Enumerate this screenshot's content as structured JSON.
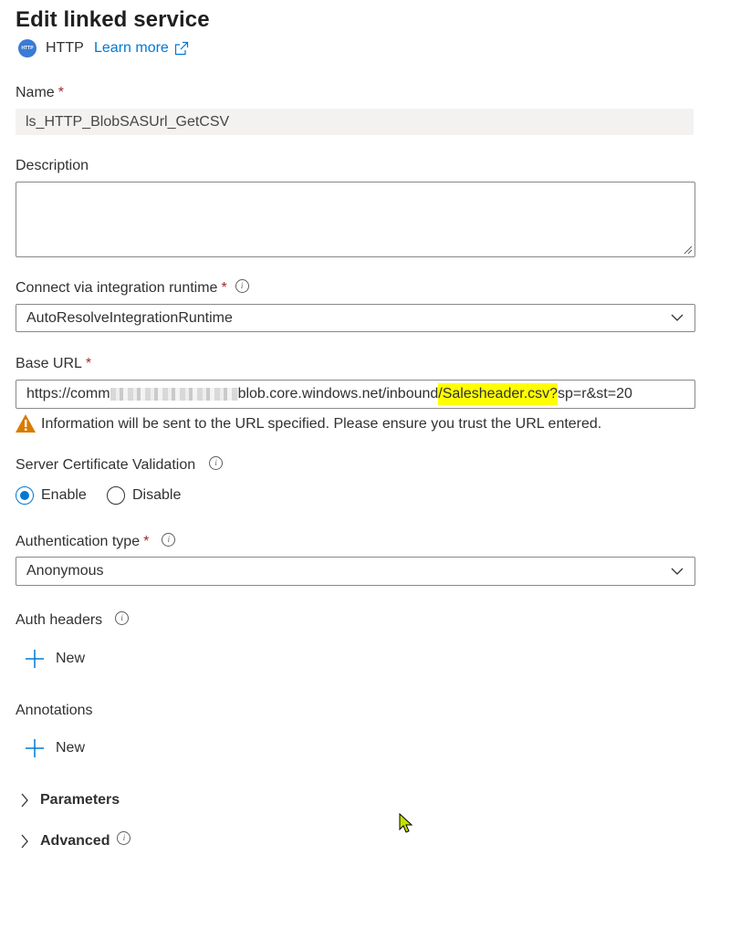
{
  "panel": {
    "title": "Edit linked service",
    "service_icon_text": "HTTP",
    "service_name": "HTTP",
    "learn_more": "Learn more"
  },
  "name": {
    "label": "Name",
    "required": "*",
    "value": "ls_HTTP_BlobSASUrl_GetCSV"
  },
  "description": {
    "label": "Description",
    "value": ""
  },
  "runtime": {
    "label": "Connect via integration runtime",
    "required": "*",
    "value": "AutoResolveIntegrationRuntime"
  },
  "base_url": {
    "label": "Base URL",
    "required": "*",
    "value_prefix": "https://comm",
    "value_middle": "blob.core.windows.net/inbound",
    "value_highlight": "/Salesheader.csv?",
    "value_suffix": "sp=r&st=20",
    "warning": "Information will be sent to the URL specified. Please ensure you trust the URL entered."
  },
  "cert_validation": {
    "label": "Server Certificate Validation",
    "options": [
      "Enable",
      "Disable"
    ],
    "selected": "Enable"
  },
  "auth_type": {
    "label": "Authentication type",
    "required": "*",
    "value": "Anonymous"
  },
  "auth_headers": {
    "label": "Auth headers",
    "new_label": "New"
  },
  "annotations": {
    "label": "Annotations",
    "new_label": "New"
  },
  "parameters": {
    "label": "Parameters"
  },
  "advanced": {
    "label": "Advanced"
  },
  "icons": {
    "service": "http-globe-icon",
    "external": "external-link-icon",
    "info": "info-icon",
    "chevron": "chevron-down-icon",
    "warning": "warning-icon",
    "add": "plus-icon",
    "expand": "chevron-right-icon",
    "cursor": "mouse-pointer-icon"
  },
  "colors": {
    "accent": "#0078d4",
    "required": "#a4262c",
    "highlight": "#ffff00",
    "warning": "#d97b00"
  }
}
